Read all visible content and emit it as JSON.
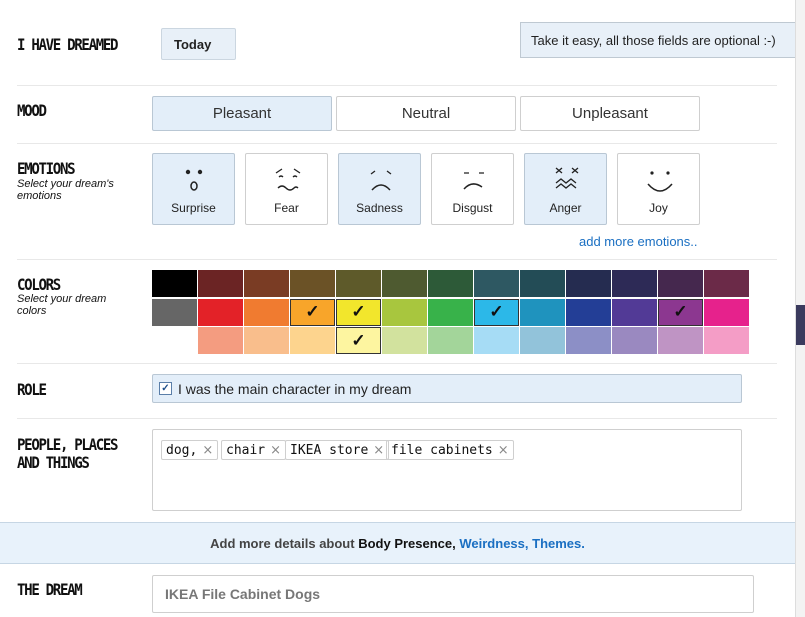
{
  "dreamed": {
    "label": "I HAVE DREAMED",
    "date": "Today"
  },
  "tooltip": "Take it easy, all those fields are optional :-)",
  "mood": {
    "label": "MOOD",
    "options": [
      {
        "label": "Pleasant",
        "selected": true
      },
      {
        "label": "Neutral",
        "selected": false
      },
      {
        "label": "Unpleasant",
        "selected": false
      }
    ]
  },
  "emotions": {
    "label": "EMOTIONS",
    "subtitle": "Select your dream's emotions",
    "items": [
      {
        "label": "Surprise",
        "icon": "surprise-face-icon",
        "selected": true
      },
      {
        "label": "Fear",
        "icon": "fear-face-icon",
        "selected": false
      },
      {
        "label": "Sadness",
        "icon": "sad-face-icon",
        "selected": true
      },
      {
        "label": "Disgust",
        "icon": "disgust-face-icon",
        "selected": false
      },
      {
        "label": "Anger",
        "icon": "anger-face-icon",
        "selected": true
      },
      {
        "label": "Joy",
        "icon": "joy-face-icon",
        "selected": false
      }
    ],
    "more_link": "add more emotions.."
  },
  "colors": {
    "label": "COLORS",
    "subtitle": "Select your dream colors",
    "rows": [
      [
        "#000000",
        "#6b2424",
        "#7a3c24",
        "#6b5226",
        "#5e5a2a",
        "#4e5a30",
        "#2d5a38",
        "#2e5862",
        "#234c56",
        "#252c50",
        "#2d2a56",
        "#45284e",
        "#6b2a48"
      ],
      [
        "#666666",
        "#e32228",
        "#f07b30",
        "#f8a52a",
        "#f2e62c",
        "#a8c63e",
        "#38b24a",
        "#2cb8e8",
        "#1f93be",
        "#233e96",
        "#523a96",
        "#8c3790",
        "#e6228c"
      ],
      [
        null,
        "#f49c80",
        "#f9be8c",
        "#fdd48e",
        "#fdf5a0",
        "#d2e29e",
        "#a3d59a",
        "#a6dcf5",
        "#92c3da",
        "#8c8fc6",
        "#9a89c0",
        "#bf94c4",
        "#f49dc6"
      ]
    ],
    "selected": [
      [
        1,
        3
      ],
      [
        1,
        4
      ],
      [
        1,
        7
      ],
      [
        1,
        11
      ],
      [
        2,
        4
      ]
    ],
    "check_mark": "✓"
  },
  "role": {
    "label": "ROLE",
    "checkbox_label": "I was the main character in my dream",
    "checked": true,
    "check_mark": "✓"
  },
  "people": {
    "label_line1": "PEOPLE, PLACES",
    "label_line2": "AND THINGS",
    "tags": [
      "dog,",
      "chair",
      "IKEA store",
      "file cabinets"
    ],
    "remove_glyph": "×"
  },
  "details": {
    "prefix": "Add more details about",
    "links": [
      "Body Presence,",
      "Weirdness,",
      "Themes."
    ]
  },
  "dream": {
    "label": "THE DREAM",
    "title_value": "IKEA File Cabinet Dogs"
  }
}
